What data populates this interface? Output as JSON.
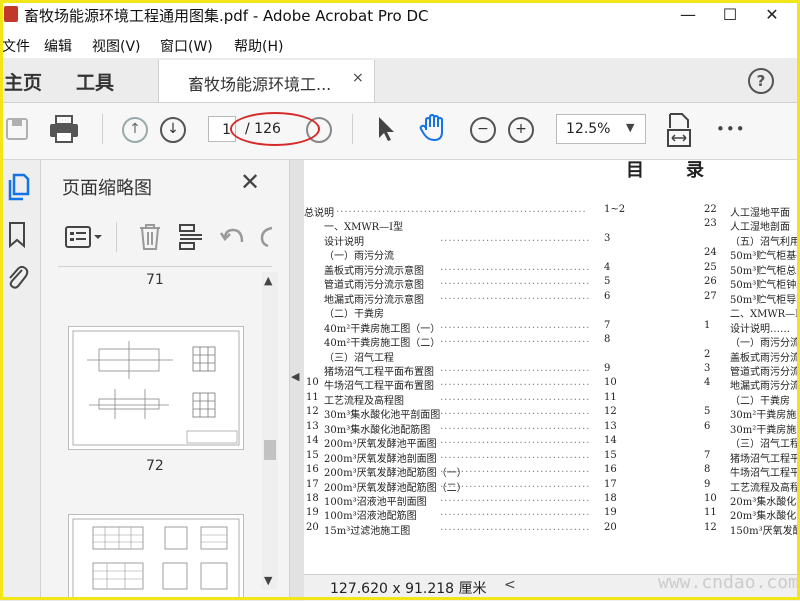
{
  "window": {
    "title": "畜牧场能源环境工程通用图集.pdf - Adobe Acrobat Pro DC",
    "controls": {
      "minimize": "—",
      "maximize": "☐",
      "close": "✕"
    }
  },
  "menu": [
    "文件",
    "编辑",
    "视图(V)",
    "窗口(W)",
    "帮助(H)"
  ],
  "tabs": {
    "home": "主页",
    "tools": "工具",
    "document": "畜牧场能源环境工...",
    "doc_close": "×",
    "help": "?"
  },
  "toolbar": {
    "page_current": "1",
    "page_total": "/ 126",
    "zoom": "12.5%",
    "more": "•••"
  },
  "thumbnail_panel": {
    "title": "页面缩略图",
    "close": "✕",
    "page_labels": [
      "71",
      "72"
    ]
  },
  "document": {
    "heading_chars": [
      "目",
      "录"
    ],
    "col1": [
      {
        "t": "总说明",
        "p": "1~2"
      },
      {
        "t": "一、XMWR—Ⅰ型",
        "p": ""
      },
      {
        "t": "设计说明",
        "p": "3"
      },
      {
        "t": "（一）雨污分流",
        "p": ""
      },
      {
        "t": "盖板式雨污分流示意图",
        "p": "4"
      },
      {
        "t": "管道式雨污分流示意图",
        "p": "5"
      },
      {
        "t": "地漏式雨污分流示意图",
        "p": "6"
      },
      {
        "t": "（二）干粪房",
        "p": ""
      },
      {
        "t": "40m²干粪房施工图（一）",
        "p": "7"
      },
      {
        "t": "40m²干粪房施工图（二）",
        "p": "8"
      },
      {
        "t": "（三）沼气工程",
        "p": ""
      },
      {
        "t": "猪场沼气工程平面布置图",
        "p": "9"
      },
      {
        "t": "牛场沼气工程平面布置图",
        "p": "10"
      },
      {
        "t": "工艺流程及高程图",
        "p": "11"
      },
      {
        "t": "30m³集水酸化池平剖面图",
        "p": "12"
      },
      {
        "t": "30m³集水酸化池配筋图",
        "p": "13"
      },
      {
        "t": "200m³厌氧发酵池平面图",
        "p": "14"
      },
      {
        "t": "200m³厌氧发酵池剖面图",
        "p": "15"
      },
      {
        "t": "200m³厌氧发酵池配筋图（一）",
        "p": "16"
      },
      {
        "t": "200m³厌氧发酵池配筋图（二）",
        "p": "17"
      },
      {
        "t": "100m³沼液池平剖面图",
        "p": "18"
      },
      {
        "t": "100m³沼液池配筋图",
        "p": "19"
      },
      {
        "t": "15m³过滤池施工图",
        "p": "20"
      }
    ],
    "col1_nums": [
      "10",
      "11",
      "12",
      "13",
      "14",
      "15",
      "16",
      "17",
      "18",
      "19",
      "20"
    ],
    "col2": [
      {
        "n": "22",
        "t": "人工湿地平面"
      },
      {
        "n": "23",
        "t": "人工湿地剖面"
      },
      {
        "n": "",
        "t": "（五）沼气利用"
      },
      {
        "n": "24",
        "t": "50m³贮气柜基础"
      },
      {
        "n": "25",
        "t": "50m³贮气柜总装"
      },
      {
        "n": "26",
        "t": "50m³贮气柜钟罩"
      },
      {
        "n": "27",
        "t": "50m³贮气柜导轨"
      },
      {
        "n": "",
        "t": "二、XMWR—Ⅱ型"
      },
      {
        "n": "1",
        "t": "设计说明……"
      },
      {
        "n": "",
        "t": "（一）雨污分流"
      },
      {
        "n": "2",
        "t": "盖板式雨污分流"
      },
      {
        "n": "3",
        "t": "管道式雨污分流"
      },
      {
        "n": "4",
        "t": "地漏式雨污分流"
      },
      {
        "n": "",
        "t": "（二）干粪房"
      },
      {
        "n": "5",
        "t": "30m²干粪房施工"
      },
      {
        "n": "6",
        "t": "30m²干粪房施工"
      },
      {
        "n": "",
        "t": "（三）沼气工程"
      },
      {
        "n": "7",
        "t": "猪场沼气工程平"
      },
      {
        "n": "8",
        "t": "牛场沼气工程平"
      },
      {
        "n": "9",
        "t": "工艺流程及高程"
      },
      {
        "n": "10",
        "t": "20m³集水酸化池"
      },
      {
        "n": "11",
        "t": "20m³集水酸化池"
      },
      {
        "n": "12",
        "t": "150m³厌氧发酵"
      }
    ]
  },
  "status": {
    "doc_size": "127.620 x 91.218 厘米",
    "watermark": "www.cndao.com"
  }
}
